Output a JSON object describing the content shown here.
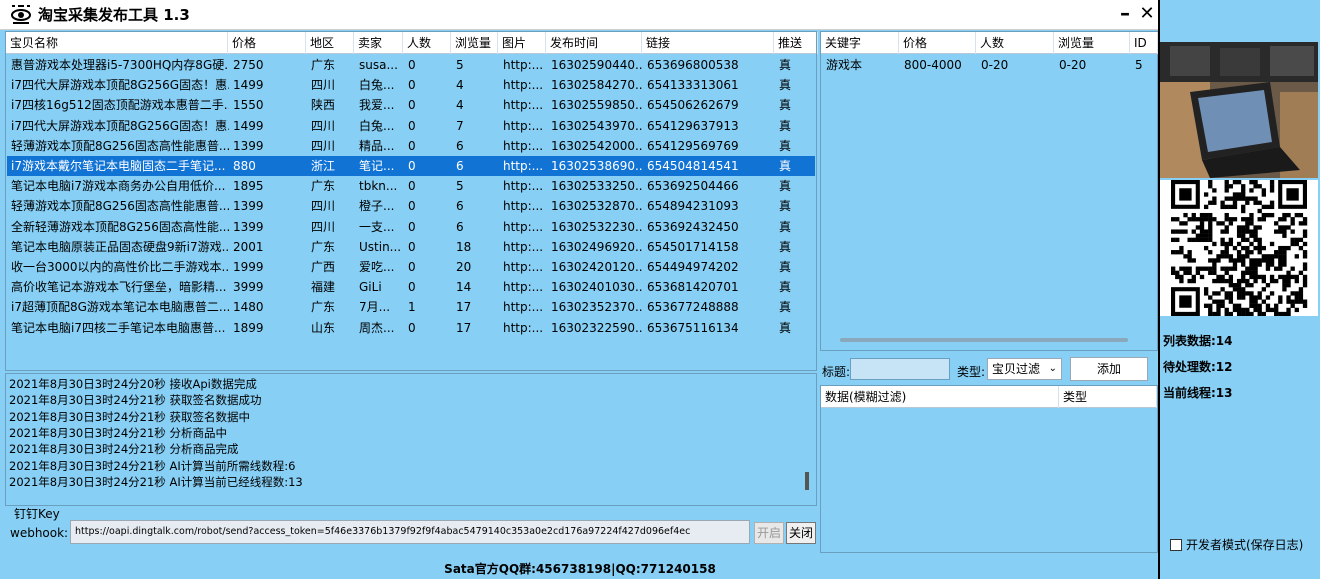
{
  "window": {
    "title": "淘宝采集发布工具 1.3",
    "minimize": "–",
    "close": "✕"
  },
  "main_table": {
    "headers": [
      "宝贝名称",
      "价格",
      "地区",
      "卖家",
      "人数",
      "浏览量",
      "图片",
      "发布时间",
      "链接",
      "推送"
    ],
    "rows": [
      [
        "惠普游戏本处理器i5-7300HQ内存8G硬...",
        "2750",
        "广东",
        "susa...",
        "0",
        "5",
        "http:...",
        "16302590440...",
        "653696800538",
        "真"
      ],
      [
        "i7四代大屏游戏本顶配8G256G固态！惠...",
        "1499",
        "四川",
        "白兔...",
        "0",
        "4",
        "http:...",
        "16302584270...",
        "654133313061",
        "真"
      ],
      [
        "i7四核16g512固态顶配游戏本惠普二手...",
        "1550",
        "陕西",
        "我爱...",
        "0",
        "4",
        "http:...",
        "16302559850...",
        "654506262679",
        "真"
      ],
      [
        "i7四代大屏游戏本顶配8G256G固态！惠...",
        "1499",
        "四川",
        "白兔...",
        "0",
        "7",
        "http:...",
        "16302543970...",
        "654129637913",
        "真"
      ],
      [
        "轻薄游戏本顶配8G256固态高性能惠普...",
        "1399",
        "四川",
        "精品...",
        "0",
        "6",
        "http:...",
        "16302542000...",
        "654129569769",
        "真"
      ],
      [
        "i7游戏本戴尔笔记本电脑固态二手笔记...",
        "880",
        "浙江",
        "笔记...",
        "0",
        "6",
        "http:...",
        "16302538690...",
        "654504814541",
        "真"
      ],
      [
        "笔记本电脑i7游戏本商务办公自用低价...",
        "1895",
        "广东",
        "tbkn...",
        "0",
        "5",
        "http:...",
        "16302533250...",
        "653692504466",
        "真"
      ],
      [
        "轻薄游戏本顶配8G256固态高性能惠普...",
        "1399",
        "四川",
        "橙子...",
        "0",
        "6",
        "http:...",
        "16302532870...",
        "654894231093",
        "真"
      ],
      [
        "全新轻薄游戏本顶配8G256固态高性能...",
        "1399",
        "四川",
        "一支...",
        "0",
        "6",
        "http:...",
        "16302532230...",
        "653692432450",
        "真"
      ],
      [
        "笔记本电脑原装正品固态硬盘9新i7游戏...",
        "2001",
        "广东",
        "Ustin...",
        "0",
        "18",
        "http:...",
        "16302496920...",
        "654501714158",
        "真"
      ],
      [
        "收一台3000以内的高性价比二手游戏本...",
        "1999",
        "广西",
        "爱吃...",
        "0",
        "20",
        "http:...",
        "16302420120...",
        "654494974202",
        "真"
      ],
      [
        "高价收笔记本游戏本飞行堡垒，暗影精...",
        "3999",
        "福建",
        "GiLi",
        "0",
        "14",
        "http:...",
        "16302401030...",
        "653681420701",
        "真"
      ],
      [
        "i7超薄顶配8G游戏本笔记本电脑惠普二...",
        "1480",
        "广东",
        "7月...",
        "1",
        "17",
        "http:...",
        "16302352370...",
        "653677248888",
        "真"
      ],
      [
        "笔记本电脑i7四核二手笔记本电脑惠普...",
        "1899",
        "山东",
        "周杰...",
        "0",
        "17",
        "http:...",
        "16302322590...",
        "653675116134",
        "真"
      ]
    ],
    "selected_row": 5
  },
  "keyword_table": {
    "headers": [
      "关键字",
      "价格",
      "人数",
      "浏览量",
      "ID"
    ],
    "rows": [
      [
        "游戏本",
        "800-4000",
        "0-20",
        "0-20",
        "5"
      ]
    ]
  },
  "log": [
    "2021年8月30日3时24分20秒  接收Api数据完成",
    "2021年8月30日3时24分21秒  获取签名数据成功",
    "2021年8月30日3时24分21秒  获取签名数据中",
    "2021年8月30日3时24分21秒  分析商品中",
    "2021年8月30日3时24分21秒  分析商品完成",
    "2021年8月30日3时24分21秒  AI计算当前所需线数程:6",
    "2021年8月30日3时24分21秒  AI计算当前已经线程数:13"
  ],
  "dingtalk": {
    "label": "钉钉Key",
    "webhook_label": "webhook:",
    "webhook_value": "https://oapi.dingtalk.com/robot/send?access_token=5f46e3376b1379f92f9f4abac5479140c353a0e2cd176a97224f427d096ef4ec",
    "open_label": "开启",
    "close_label": "关闭"
  },
  "filter": {
    "title_label": "标题:",
    "type_label": "类型:",
    "type_value": "宝贝过滤",
    "add_label": "添加",
    "headers": [
      "数据(模糊过滤)",
      "类型"
    ]
  },
  "stats": {
    "list_count": "列表数据:14",
    "pending_count": "待处理数:12",
    "thread_count": "当前线程:13"
  },
  "dev_mode_label": "开发者模式(保存日志)",
  "footer": "Sata官方QQ群:456738198|QQ:771240158",
  "colors": {
    "background": "#87cff5",
    "selection": "#1173d4"
  },
  "icons": [
    "eye-logo-icon",
    "minimize-icon",
    "close-icon",
    "chevron-down-icon",
    "checkbox-icon",
    "qr-code-image",
    "laptop-photo"
  ]
}
